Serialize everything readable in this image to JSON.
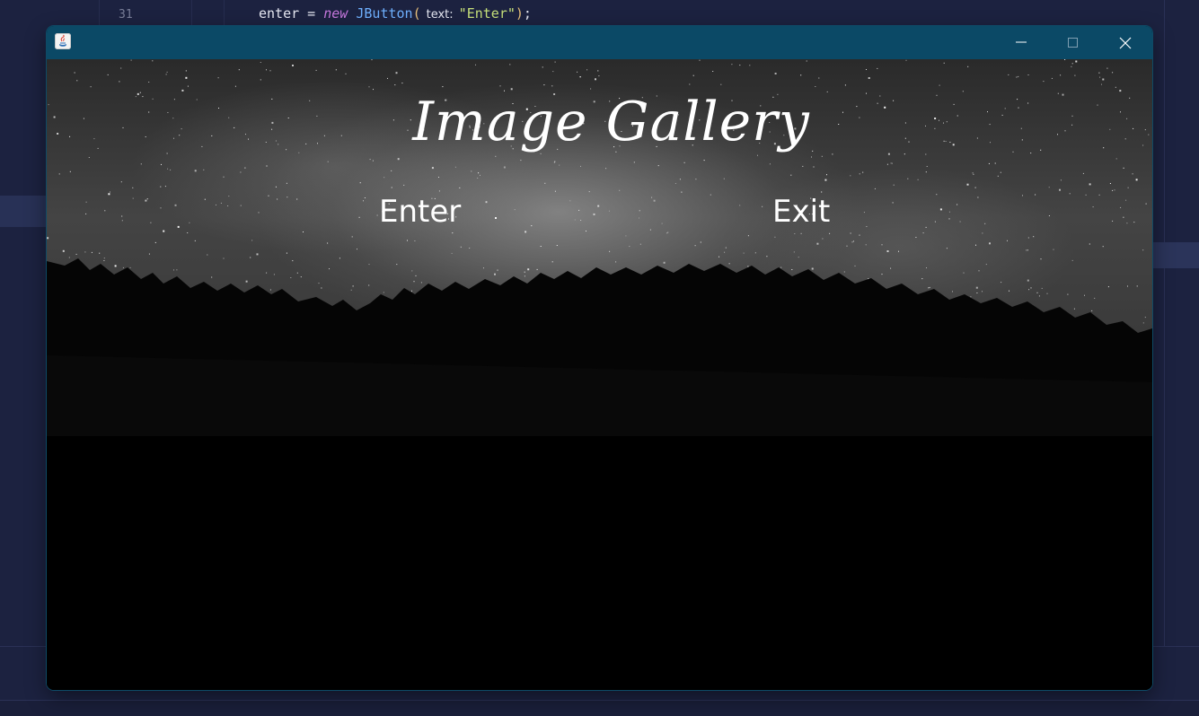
{
  "ide": {
    "line_number": "31",
    "code": {
      "var": "enter",
      "eq": " = ",
      "kw_new": "new",
      "class": "JButton",
      "paren_open": "(",
      "param_hint": "text:",
      "string": "\"Enter\"",
      "paren_close": ")",
      "semicolon": ";"
    }
  },
  "window": {
    "icon": "java-icon",
    "controls": [
      "minimize-icon",
      "maximize-icon",
      "close-icon"
    ],
    "title_bar_color": "#0b4966"
  },
  "app": {
    "title": "Image Gallery",
    "enter_label": "Enter",
    "exit_label": "Exit"
  }
}
